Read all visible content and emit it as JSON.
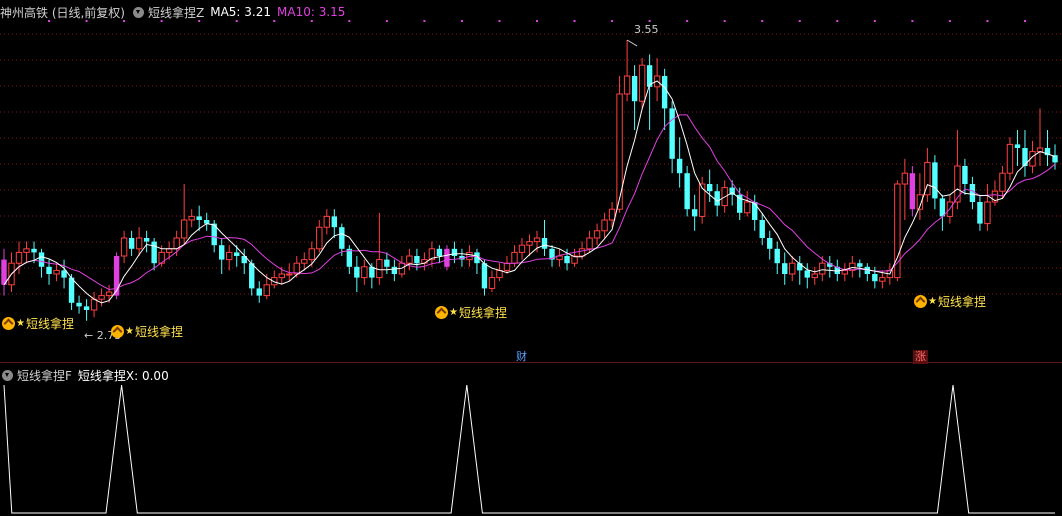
{
  "header": {
    "stock_name": "神州高铁 (日线,前复权)",
    "indicator_name": "短线拿捏Z",
    "ma5_label": "MA5: 3.21",
    "ma10_label": "MA10: 3.15"
  },
  "sub_header": {
    "indicator_name": "短线拿捏F",
    "value_label": "短线拿捏X: 0.00"
  },
  "events": {
    "cai": "财",
    "zhang": "涨"
  },
  "signals": {
    "label": "短线拿捏",
    "star": "★"
  },
  "annotations": {
    "high_label": "3.55",
    "low_label": "← 2.73"
  },
  "colors": {
    "up": "#ff4040",
    "down": "#54ffff",
    "ma5": "#ffffff",
    "ma10": "#e040e0",
    "signal_bar": "#e040e0",
    "grid": "#7a1a1a",
    "signal_text": "#ffe14d"
  },
  "chart_data": [
    {
      "type": "candlestick",
      "title": "神州高铁 (日线,前复权)",
      "ylim": [
        2.7,
        3.6
      ],
      "high": 3.55,
      "low": 2.73,
      "grid": true,
      "signal_indices": [
        0,
        15,
        59,
        121
      ],
      "candles": [
        [
          2.94,
          2.87,
          2.97,
          2.84
        ],
        [
          2.87,
          2.93,
          2.96,
          2.85
        ],
        [
          2.93,
          2.96,
          2.99,
          2.9
        ],
        [
          2.96,
          2.97,
          2.99,
          2.93
        ],
        [
          2.97,
          2.96,
          2.99,
          2.93
        ],
        [
          2.96,
          2.92,
          2.97,
          2.89
        ],
        [
          2.92,
          2.9,
          2.94,
          2.87
        ],
        [
          2.9,
          2.91,
          2.93,
          2.88
        ],
        [
          2.91,
          2.89,
          2.94,
          2.86
        ],
        [
          2.89,
          2.82,
          2.9,
          2.8
        ],
        [
          2.82,
          2.81,
          2.84,
          2.79
        ],
        [
          2.81,
          2.8,
          2.83,
          2.77
        ],
        [
          2.8,
          2.83,
          2.85,
          2.78
        ],
        [
          2.83,
          2.84,
          2.86,
          2.81
        ],
        [
          2.84,
          2.85,
          2.87,
          2.82
        ],
        [
          2.84,
          2.95,
          2.96,
          2.83
        ],
        [
          2.95,
          3.0,
          3.02,
          2.93
        ],
        [
          3.0,
          2.97,
          3.02,
          2.95
        ],
        [
          2.97,
          3.0,
          3.03,
          2.95
        ],
        [
          3.0,
          2.99,
          3.02,
          2.96
        ],
        [
          2.99,
          2.93,
          3.0,
          2.91
        ],
        [
          2.93,
          2.96,
          2.98,
          2.92
        ],
        [
          2.96,
          2.97,
          2.99,
          2.94
        ],
        [
          2.97,
          3.0,
          3.02,
          2.95
        ],
        [
          3.0,
          3.05,
          3.15,
          2.98
        ],
        [
          3.05,
          3.06,
          3.08,
          3.03
        ],
        [
          3.06,
          3.05,
          3.09,
          3.02
        ],
        [
          3.05,
          3.04,
          3.07,
          3.02
        ],
        [
          3.04,
          2.98,
          3.05,
          2.96
        ],
        [
          2.98,
          2.94,
          3.0,
          2.9
        ],
        [
          2.94,
          2.96,
          2.98,
          2.91
        ],
        [
          2.96,
          2.95,
          2.98,
          2.92
        ],
        [
          2.95,
          2.93,
          2.97,
          2.9
        ],
        [
          2.93,
          2.86,
          2.94,
          2.84
        ],
        [
          2.86,
          2.84,
          2.88,
          2.82
        ],
        [
          2.84,
          2.87,
          2.9,
          2.83
        ],
        [
          2.87,
          2.89,
          2.91,
          2.86
        ],
        [
          2.89,
          2.9,
          2.92,
          2.87
        ],
        [
          2.9,
          2.9,
          2.93,
          2.88
        ],
        [
          2.9,
          2.93,
          2.95,
          2.89
        ],
        [
          2.93,
          2.94,
          2.96,
          2.91
        ],
        [
          2.94,
          2.97,
          2.99,
          2.92
        ],
        [
          2.97,
          3.03,
          3.05,
          2.96
        ],
        [
          3.03,
          3.06,
          3.08,
          3.01
        ],
        [
          3.06,
          3.03,
          3.08,
          3.0
        ],
        [
          3.03,
          2.97,
          3.04,
          2.95
        ],
        [
          2.97,
          2.92,
          2.98,
          2.9
        ],
        [
          2.92,
          2.89,
          2.95,
          2.85
        ],
        [
          2.89,
          2.92,
          2.94,
          2.87
        ],
        [
          2.92,
          2.89,
          2.93,
          2.86
        ],
        [
          2.89,
          2.94,
          3.07,
          2.87
        ],
        [
          2.94,
          2.92,
          2.96,
          2.9
        ],
        [
          2.92,
          2.9,
          2.94,
          2.88
        ],
        [
          2.9,
          2.93,
          2.95,
          2.89
        ],
        [
          2.93,
          2.95,
          2.97,
          2.91
        ],
        [
          2.95,
          2.93,
          2.97,
          2.91
        ],
        [
          2.93,
          2.94,
          2.96,
          2.91
        ],
        [
          2.94,
          2.97,
          2.99,
          2.92
        ],
        [
          2.97,
          2.95,
          2.98,
          2.93
        ],
        [
          2.92,
          2.97,
          2.98,
          2.91
        ],
        [
          2.97,
          2.95,
          2.99,
          2.93
        ],
        [
          2.95,
          2.94,
          2.97,
          2.92
        ],
        [
          2.94,
          2.96,
          2.98,
          2.92
        ],
        [
          2.96,
          2.93,
          2.97,
          2.9
        ],
        [
          2.93,
          2.86,
          2.94,
          2.84
        ],
        [
          2.86,
          2.89,
          2.91,
          2.85
        ],
        [
          2.89,
          2.91,
          2.93,
          2.88
        ],
        [
          2.91,
          2.93,
          2.95,
          2.9
        ],
        [
          2.93,
          2.96,
          2.98,
          2.92
        ],
        [
          2.96,
          2.98,
          3.0,
          2.94
        ],
        [
          2.98,
          2.99,
          3.01,
          2.95
        ],
        [
          2.99,
          3.0,
          3.02,
          2.96
        ],
        [
          3.0,
          2.97,
          3.05,
          2.95
        ],
        [
          2.97,
          2.94,
          2.98,
          2.92
        ],
        [
          2.94,
          2.95,
          2.97,
          2.92
        ],
        [
          2.95,
          2.93,
          2.97,
          2.91
        ],
        [
          2.93,
          2.95,
          2.97,
          2.92
        ],
        [
          2.95,
          2.97,
          2.99,
          2.94
        ],
        [
          2.97,
          3.0,
          3.02,
          2.96
        ],
        [
          3.0,
          3.02,
          3.04,
          2.98
        ],
        [
          3.02,
          3.05,
          3.07,
          3.0
        ],
        [
          3.05,
          3.08,
          3.1,
          3.03
        ],
        [
          3.08,
          3.4,
          3.45,
          3.07
        ],
        [
          3.4,
          3.45,
          3.55,
          3.38
        ],
        [
          3.45,
          3.38,
          3.48,
          3.3
        ],
        [
          3.38,
          3.48,
          3.5,
          3.36
        ],
        [
          3.48,
          3.42,
          3.51,
          3.3
        ],
        [
          3.42,
          3.45,
          3.5,
          3.38
        ],
        [
          3.45,
          3.36,
          3.47,
          3.3
        ],
        [
          3.36,
          3.22,
          3.38,
          3.18
        ],
        [
          3.22,
          3.18,
          3.28,
          3.14
        ],
        [
          3.18,
          3.08,
          3.2,
          3.06
        ],
        [
          3.08,
          3.06,
          3.12,
          3.02
        ],
        [
          3.06,
          3.15,
          3.17,
          3.04
        ],
        [
          3.15,
          3.13,
          3.19,
          3.1
        ],
        [
          3.13,
          3.09,
          3.15,
          3.06
        ],
        [
          3.09,
          3.14,
          3.16,
          3.07
        ],
        [
          3.14,
          3.12,
          3.16,
          3.09
        ],
        [
          3.12,
          3.07,
          3.14,
          3.05
        ],
        [
          3.07,
          3.1,
          3.13,
          3.06
        ],
        [
          3.1,
          3.05,
          3.12,
          3.02
        ],
        [
          3.05,
          3.0,
          3.07,
          2.98
        ],
        [
          3.0,
          2.97,
          3.02,
          2.94
        ],
        [
          2.97,
          2.93,
          2.99,
          2.9
        ],
        [
          2.93,
          2.9,
          2.96,
          2.87
        ],
        [
          2.9,
          2.93,
          2.95,
          2.88
        ],
        [
          2.93,
          2.91,
          2.95,
          2.87
        ],
        [
          2.91,
          2.89,
          2.93,
          2.86
        ],
        [
          2.89,
          2.9,
          2.92,
          2.87
        ],
        [
          2.9,
          2.93,
          2.95,
          2.88
        ],
        [
          2.93,
          2.92,
          2.95,
          2.89
        ],
        [
          2.92,
          2.9,
          2.94,
          2.88
        ],
        [
          2.9,
          2.91,
          2.93,
          2.88
        ],
        [
          2.91,
          2.93,
          2.95,
          2.89
        ],
        [
          2.93,
          2.92,
          2.94,
          2.89
        ],
        [
          2.92,
          2.9,
          2.93,
          2.88
        ],
        [
          2.9,
          2.88,
          2.92,
          2.86
        ],
        [
          2.88,
          2.89,
          2.91,
          2.86
        ],
        [
          2.89,
          2.91,
          2.93,
          2.87
        ],
        [
          2.89,
          3.15,
          3.16,
          2.88
        ],
        [
          3.15,
          3.18,
          3.22,
          3.05
        ],
        [
          3.18,
          3.08,
          3.2,
          3.06
        ],
        [
          3.08,
          3.12,
          3.18,
          3.05
        ],
        [
          3.12,
          3.21,
          3.25,
          3.1
        ],
        [
          3.21,
          3.11,
          3.23,
          3.08
        ],
        [
          3.11,
          3.06,
          3.12,
          3.02
        ],
        [
          3.06,
          3.1,
          3.12,
          3.04
        ],
        [
          3.1,
          3.2,
          3.3,
          3.08
        ],
        [
          3.2,
          3.15,
          3.22,
          3.12
        ],
        [
          3.15,
          3.1,
          3.17,
          3.08
        ],
        [
          3.1,
          3.04,
          3.12,
          3.02
        ],
        [
          3.04,
          3.1,
          3.15,
          3.02
        ],
        [
          3.1,
          3.13,
          3.16,
          3.09
        ],
        [
          3.13,
          3.18,
          3.2,
          3.11
        ],
        [
          3.18,
          3.26,
          3.28,
          3.16
        ],
        [
          3.26,
          3.25,
          3.3,
          3.2
        ],
        [
          3.25,
          3.2,
          3.3,
          3.17
        ],
        [
          3.2,
          3.24,
          3.27,
          3.18
        ],
        [
          3.24,
          3.25,
          3.36,
          3.2
        ],
        [
          3.25,
          3.23,
          3.3,
          3.2
        ],
        [
          3.23,
          3.21,
          3.26,
          3.19
        ]
      ]
    },
    {
      "type": "line",
      "title": "短线拿捏F",
      "ylim": [
        0,
        1
      ],
      "x_count": 135,
      "peaks": [
        15,
        59,
        121
      ],
      "peak_value": 1,
      "peak_half_width": 2
    }
  ]
}
